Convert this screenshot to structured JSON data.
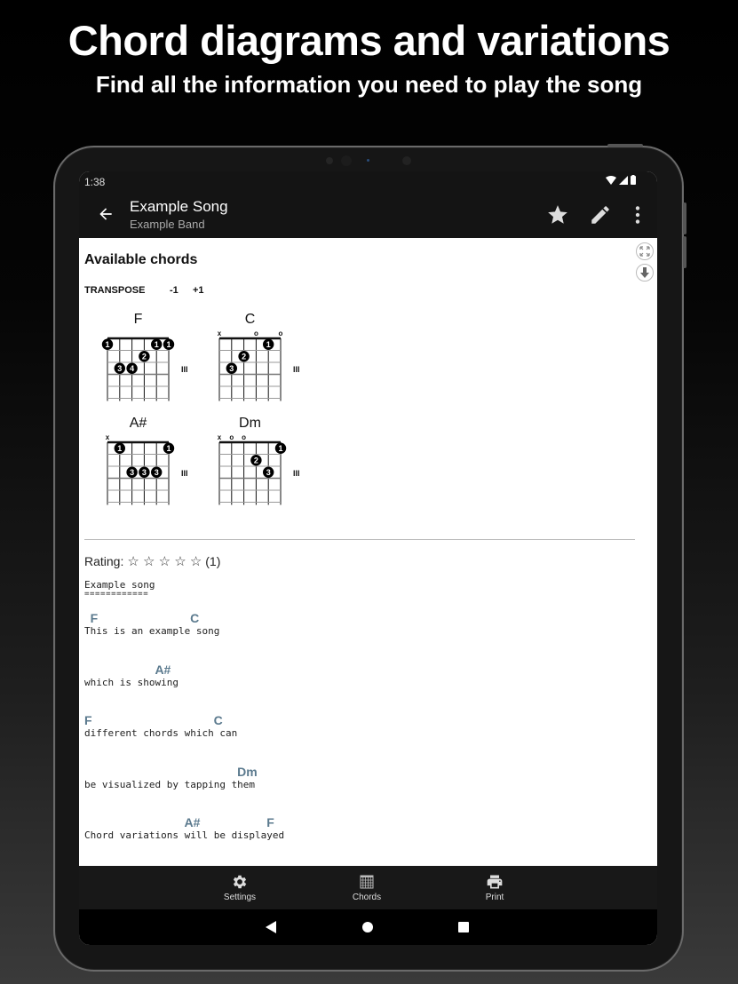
{
  "promo": {
    "title": "Chord diagrams and variations",
    "subtitle": "Find all the information you need to play the song"
  },
  "status_bar": {
    "time": "1:38",
    "icons": [
      "wifi-icon",
      "signal-icon",
      "battery-icon"
    ]
  },
  "app_bar": {
    "title": "Example Song",
    "subtitle": "Example Band",
    "actions": [
      "back-icon",
      "star-icon",
      "edit-icon",
      "more-vert-icon"
    ]
  },
  "chords_section": {
    "title": "Available chords",
    "transpose_label": "TRANSPOSE",
    "transpose_down": "-1",
    "transpose_up": "+1",
    "position_marker": "III",
    "chords": [
      {
        "name": "F",
        "string_marks": [
          "",
          "",
          "",
          "",
          "",
          ""
        ],
        "dots": [
          {
            "string": 1,
            "fret": 1,
            "finger": "1"
          },
          {
            "string": 5,
            "fret": 1,
            "finger": "1"
          },
          {
            "string": 6,
            "fret": 1,
            "finger": "1"
          },
          {
            "string": 4,
            "fret": 2,
            "finger": "2"
          },
          {
            "string": 2,
            "fret": 3,
            "finger": "3"
          },
          {
            "string": 3,
            "fret": 3,
            "finger": "4"
          }
        ]
      },
      {
        "name": "C",
        "string_marks": [
          "x",
          "",
          "",
          "o",
          "",
          "o"
        ],
        "dots": [
          {
            "string": 5,
            "fret": 1,
            "finger": "1"
          },
          {
            "string": 3,
            "fret": 2,
            "finger": "2"
          },
          {
            "string": 2,
            "fret": 3,
            "finger": "3"
          }
        ]
      },
      {
        "name": "A#",
        "string_marks": [
          "x",
          "",
          "",
          "",
          "",
          ""
        ],
        "dots": [
          {
            "string": 2,
            "fret": 1,
            "finger": "1"
          },
          {
            "string": 6,
            "fret": 1,
            "finger": "1"
          },
          {
            "string": 3,
            "fret": 3,
            "finger": "3"
          },
          {
            "string": 4,
            "fret": 3,
            "finger": "3"
          },
          {
            "string": 5,
            "fret": 3,
            "finger": "3"
          }
        ]
      },
      {
        "name": "Dm",
        "string_marks": [
          "x",
          "o",
          "o",
          "",
          "",
          ""
        ],
        "dots": [
          {
            "string": 6,
            "fret": 1,
            "finger": "1"
          },
          {
            "string": 4,
            "fret": 2,
            "finger": "2"
          },
          {
            "string": 5,
            "fret": 3,
            "finger": "3"
          }
        ]
      }
    ]
  },
  "rating": {
    "label": "Rating:",
    "stars": "☆ ☆ ☆ ☆ ☆",
    "count": "(1)",
    "max": 5,
    "value": 0
  },
  "song": {
    "heading": "Example song",
    "underline": "============",
    "lines": [
      {
        "chords": [
          {
            "sym": "F",
            "col": 1
          },
          {
            "sym": "C",
            "col": 18
          }
        ],
        "lyric": "This is an example song"
      },
      {
        "chords": [
          {
            "sym": "A#",
            "col": 12
          }
        ],
        "lyric": "which is showing"
      },
      {
        "chords": [
          {
            "sym": "F",
            "col": 0
          },
          {
            "sym": "C",
            "col": 22
          }
        ],
        "lyric": "different chords which can"
      },
      {
        "chords": [
          {
            "sym": "Dm",
            "col": 26
          }
        ],
        "lyric": "be visualized by tapping them"
      },
      {
        "chords": [
          {
            "sym": "A#",
            "col": 17
          },
          {
            "sym": "F",
            "col": 31
          }
        ],
        "lyric": "Chord variations will be displayed"
      }
    ]
  },
  "bottom_nav": {
    "items": [
      {
        "label": "Settings",
        "icon": "gear-icon"
      },
      {
        "label": "Chords",
        "icon": "chord-grid-icon"
      },
      {
        "label": "Print",
        "icon": "printer-icon"
      }
    ]
  },
  "system_nav": [
    "back-triangle-icon",
    "home-circle-icon",
    "recents-square-icon"
  ]
}
